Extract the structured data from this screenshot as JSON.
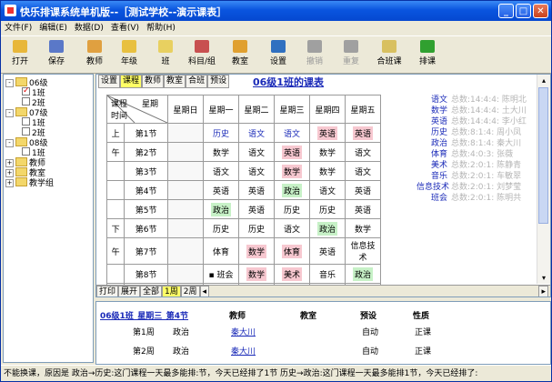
{
  "window": {
    "title": "快乐排课系统单机版--［测试学校--演示课表］",
    "min_label": "_",
    "max_label": "□",
    "close_label": "✕"
  },
  "menu": [
    "文件(F)",
    "编辑(E)",
    "数据(D)",
    "查看(V)",
    "帮助(H)"
  ],
  "toolbar": [
    {
      "label": "打开",
      "icon": "folder-open-icon",
      "color": "#e8b73a",
      "disabled": false
    },
    {
      "label": "保存",
      "icon": "floppy-icon",
      "color": "#5a78c8",
      "disabled": false
    },
    {
      "label": "教师",
      "icon": "teacher-icon",
      "color": "#e0a040",
      "disabled": false
    },
    {
      "label": "年级",
      "icon": "grade-icon",
      "color": "#e8c040",
      "disabled": false
    },
    {
      "label": "班",
      "icon": "class-icon",
      "color": "#e8d060",
      "disabled": false
    },
    {
      "label": "科目/组",
      "icon": "subject-icon",
      "color": "#c85050",
      "disabled": false
    },
    {
      "label": "教室",
      "icon": "classroom-icon",
      "color": "#e0a030",
      "disabled": false
    },
    {
      "label": "设置",
      "icon": "settings-icon",
      "color": "#3070c0",
      "disabled": false
    },
    {
      "label": "撤销",
      "icon": "undo-icon",
      "color": "#a0a0a0",
      "disabled": true
    },
    {
      "label": "重复",
      "icon": "redo-icon",
      "color": "#a0a0a0",
      "disabled": true
    },
    {
      "label": "合班课",
      "icon": "merge-class-icon",
      "color": "#d8c060",
      "disabled": false
    },
    {
      "label": "排课",
      "icon": "schedule-run-icon",
      "color": "#30a030",
      "disabled": false
    }
  ],
  "tree": [
    {
      "label": "06级",
      "level": 0,
      "type": "folder",
      "expander": "-"
    },
    {
      "label": "1班",
      "level": 1,
      "type": "check",
      "checked": true
    },
    {
      "label": "2班",
      "level": 1,
      "type": "check",
      "checked": false
    },
    {
      "label": "07级",
      "level": 0,
      "type": "folder",
      "expander": "-"
    },
    {
      "label": "1班",
      "level": 1,
      "type": "check",
      "checked": false
    },
    {
      "label": "2班",
      "level": 1,
      "type": "check",
      "checked": false
    },
    {
      "label": "08级",
      "level": 0,
      "type": "folder",
      "expander": "-"
    },
    {
      "label": "1班",
      "level": 1,
      "type": "check",
      "checked": false
    },
    {
      "label": "教师",
      "level": 0,
      "type": "folder",
      "expander": "+"
    },
    {
      "label": "教室",
      "level": 0,
      "type": "folder",
      "expander": "+"
    },
    {
      "label": "教学组",
      "level": 0,
      "type": "folder",
      "expander": "+"
    }
  ],
  "main": {
    "tabs": [
      "设置",
      "课程",
      "教师",
      "教室",
      "合班",
      "预设"
    ],
    "active_tab": 1,
    "page_title": "06级1班的课表",
    "corner": {
      "top": "课程",
      "right": "星期",
      "bottom": "时间"
    },
    "days": [
      "星期日",
      "星期一",
      "星期二",
      "星期三",
      "星期四",
      "星期五"
    ],
    "rows": [
      {
        "section": "上",
        "period": "第1节",
        "cells": [
          {
            "t": ""
          },
          {
            "t": "历史",
            "c": "blue"
          },
          {
            "t": "语文",
            "c": "blue"
          },
          {
            "t": "语文",
            "c": "blue"
          },
          {
            "t": "英语",
            "c": "pink"
          },
          {
            "t": "英语",
            "c": "pink"
          }
        ]
      },
      {
        "section": "午",
        "period": "第2节",
        "cells": [
          {
            "t": ""
          },
          {
            "t": "数学"
          },
          {
            "t": "语文"
          },
          {
            "t": "英语",
            "c": "pink"
          },
          {
            "t": "数学"
          },
          {
            "t": "语文"
          }
        ]
      },
      {
        "section": "",
        "period": "第3节",
        "cells": [
          {
            "t": ""
          },
          {
            "t": "语文"
          },
          {
            "t": "语文"
          },
          {
            "t": "数学",
            "c": "pink"
          },
          {
            "t": "数学"
          },
          {
            "t": "语文"
          }
        ]
      },
      {
        "section": "",
        "period": "第4节",
        "cells": [
          {
            "t": ""
          },
          {
            "t": "英语"
          },
          {
            "t": "英语"
          },
          {
            "t": "政治",
            "c": "green"
          },
          {
            "t": "语文"
          },
          {
            "t": "英语"
          }
        ]
      },
      {
        "section": "",
        "period": "第5节",
        "cells": [
          {
            "t": ""
          },
          {
            "t": "政治",
            "c": "green"
          },
          {
            "t": "英语"
          },
          {
            "t": "历史"
          },
          {
            "t": "历史"
          },
          {
            "t": "英语"
          }
        ]
      },
      {
        "section": "下",
        "period": "第6节",
        "cells": [
          {
            "t": ""
          },
          {
            "t": "历史"
          },
          {
            "t": "历史"
          },
          {
            "t": "语文"
          },
          {
            "t": "政治",
            "c": "green"
          },
          {
            "t": "数学"
          }
        ]
      },
      {
        "section": "午",
        "period": "第7节",
        "cells": [
          {
            "t": ""
          },
          {
            "t": "体育"
          },
          {
            "t": "数学",
            "c": "pink"
          },
          {
            "t": "体育",
            "c": "pink"
          },
          {
            "t": "英语"
          },
          {
            "t": "信息技术"
          }
        ]
      },
      {
        "section": "",
        "period": "第8节",
        "cells": [
          {
            "t": ""
          },
          {
            "t": "班会",
            "c": "mark"
          },
          {
            "t": "数学",
            "c": "pink"
          },
          {
            "t": "美术",
            "c": "pink"
          },
          {
            "t": "音乐"
          },
          {
            "t": "政治",
            "c": "green"
          }
        ]
      },
      {
        "section": "",
        "period": "第9节",
        "cells": [
          {
            "t": "政治",
            "c": "greenblue"
          },
          {
            "t": "语文",
            "c": "blue"
          },
          {
            "t": "英语",
            "c": "blue"
          },
          {
            "t": "英语",
            "c": "blue"
          },
          {
            "t": "政治",
            "c": "green"
          },
          {
            "t": ""
          }
        ]
      }
    ],
    "legend": [
      {
        "name": "语文",
        "detail": "总数:14:4:4: 陈明北"
      },
      {
        "name": "数学",
        "detail": "总数:14:4:4: 土大川"
      },
      {
        "name": "英语",
        "detail": "总数:14:4:4: 李小红"
      },
      {
        "name": "历史",
        "detail": "总数:8:1:4: 周小凤"
      },
      {
        "name": "政治",
        "detail": "总数:8:1:4: 秦大川"
      },
      {
        "name": "体育",
        "detail": "总数:4:0:3: 张薇"
      },
      {
        "name": "美术",
        "detail": "总数:2:0:1: 陈静青"
      },
      {
        "name": "音乐",
        "detail": "总数:2:0:1: 车敏翠"
      },
      {
        "name": "信息技术",
        "detail": "总数:2:0:1: 刘梦莹"
      },
      {
        "name": "班会",
        "detail": "总数:2:0:1: 陈明共"
      }
    ],
    "bottom_tabs": [
      "打印",
      "展开",
      "全部",
      "1周",
      "2周"
    ],
    "active_bottom_tab": 3,
    "scroll_left": "◂",
    "scroll_right": "▸",
    "scroll_up": "▴",
    "scroll_down": "▾"
  },
  "detail": {
    "title": "06级1班_星期三_第4节",
    "headers": {
      "teacher": "教师",
      "room": "教室",
      "preset": "预设",
      "nature": "性质"
    },
    "rows": [
      {
        "period": "第1周",
        "subject": "政治",
        "teacher": "秦大川",
        "preset": "自动",
        "nature": "正课"
      },
      {
        "period": "第2周",
        "subject": "政治",
        "teacher": "秦大川",
        "preset": "自动",
        "nature": "正课"
      }
    ]
  },
  "status": "不能换课，原因是 政治→历史:这门课程一天最多能排:节，今天已经排了1节  历史→政治:这门课程一天最多能排1节，今天已经排了:"
}
